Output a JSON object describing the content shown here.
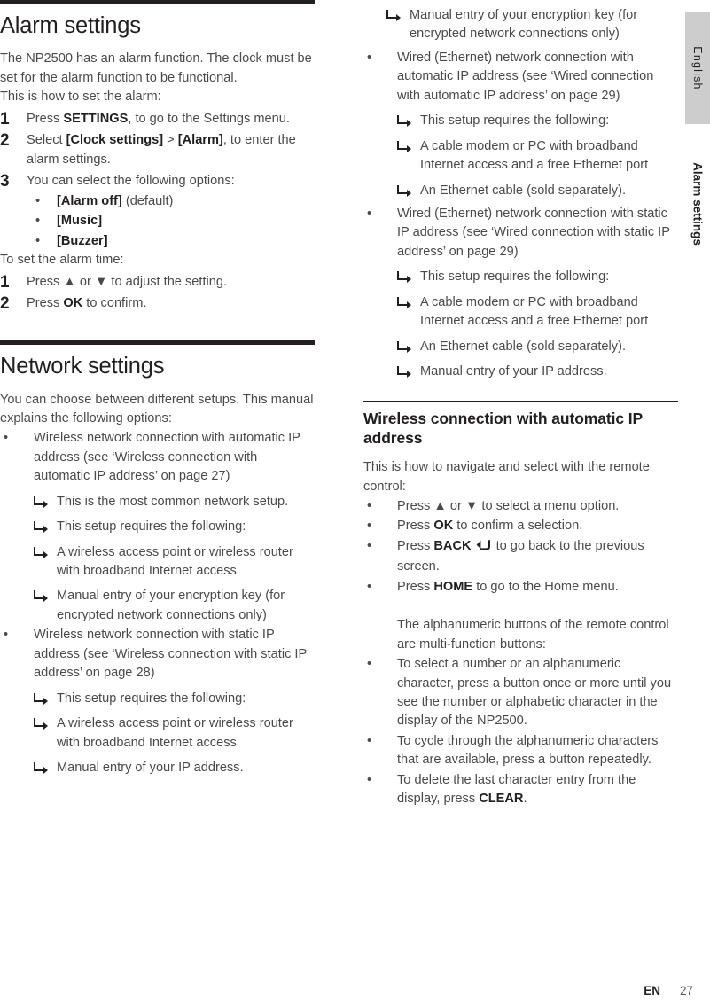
{
  "side_tab": {
    "language": "English",
    "chapter": "Alarm settings"
  },
  "footer": {
    "language_code": "EN",
    "page_number": "27"
  },
  "left_column": {
    "alarm_section": {
      "title": "Alarm settings",
      "intro": "The NP2500 has an alarm function. The clock must be set for the alarm function to be functional.",
      "intro2": "This is how to set the alarm:",
      "steps": [
        {
          "number": "1",
          "text_before": "Press ",
          "bold": "SETTINGS",
          "text_after": ", to go to the Settings menu."
        },
        {
          "number": "2",
          "text_before": "Select ",
          "bold": "[Clock settings]",
          "text_mid": " > ",
          "bold2": "[Alarm]",
          "text_after": ", to enter the alarm settings."
        },
        {
          "number": "3",
          "text_before": "You can select the following options:",
          "options": [
            {
              "bold": "[Alarm off]",
              "suffix": " (default)"
            },
            {
              "bold": "[Music]",
              "suffix": ""
            },
            {
              "bold": "[Buzzer]",
              "suffix": ""
            }
          ]
        }
      ],
      "time_intro": "To set the alarm time:",
      "time_steps": [
        {
          "number": "1",
          "text_before": "Press ",
          "symbol_up": "▲",
          "text_mid": " or ",
          "symbol_down": "▼",
          "text_after": " to adjust the setting."
        },
        {
          "number": "2",
          "text_before": "Press ",
          "bold": "OK",
          "text_after": " to confirm."
        }
      ]
    },
    "network_section": {
      "title": "Network settings",
      "intro": "You can choose between different setups. This manual explains the following options:",
      "bullets": [
        {
          "mark": "•",
          "text": "Wireless network connection with automatic IP address (see ‘Wireless connection with automatic IP address’ on page 27)",
          "subs": [
            "This is the most common network setup.",
            "This setup requires the following:",
            "A wireless access point or wireless router with broadband Internet access",
            "Manual entry of your encryption key (for encrypted network connections only)"
          ]
        },
        {
          "mark": "•",
          "text": "Wireless network connection with static IP address (see ‘Wireless connection with static IP address’ on page 28)",
          "subs": [
            "This setup requires the following:",
            "A wireless access point or wireless router with broadband Internet access",
            "Manual entry of your IP address."
          ]
        }
      ]
    }
  },
  "right_column": {
    "continued_subs_top": [
      "Manual entry of your encryption key (for encrypted network connections only)"
    ],
    "bullets": [
      {
        "mark": "•",
        "text": "Wired (Ethernet) network connection with automatic IP address (see ‘Wired connection with automatic IP address’ on page 29)",
        "subs": [
          "This setup requires the following:",
          "A cable modem or PC with broadband Internet access and a free Ethernet port",
          "An Ethernet cable (sold separately)."
        ]
      },
      {
        "mark": "•",
        "text": "Wired (Ethernet) network connection with static IP address (see ‘Wired connection with static IP address’ on page 29)",
        "subs": [
          "This setup requires the following:",
          "A cable modem or PC with broadband Internet access and a free Ethernet port",
          "An Ethernet cable (sold separately).",
          "Manual entry of your IP address."
        ]
      }
    ],
    "wireless_section": {
      "title": "Wireless connection with automatic IP address",
      "intro": "This is how to navigate and select with the remote control:",
      "nav_bullets": [
        {
          "mark": "•",
          "text_before": "Press ",
          "symbol_up": "▲",
          "text_mid": " or ",
          "symbol_down": "▼",
          "text_after": " to select a menu option."
        },
        {
          "mark": "•",
          "text_before": "Press ",
          "bold": "OK",
          "text_after": " to confirm a selection."
        },
        {
          "mark": "•",
          "text_before": "Press ",
          "bold": "BACK",
          "icon": "back-arrow-icon",
          "text_after": " to go back to the previous screen."
        },
        {
          "mark": "•",
          "text_before": "Press ",
          "bold": "HOME",
          "text_after": " to go to the Home menu."
        }
      ],
      "alphanumeric_intro": "The alphanumeric buttons of the remote control are multi-function buttons:",
      "alphanumeric_bullets": [
        {
          "mark": "•",
          "text": "To select a number or an alphanumeric character, press a button once or more until you see the number or alphabetic character in the display of the NP2500."
        },
        {
          "mark": "•",
          "text": "To cycle through the alphanumeric characters that are available, press a button repeatedly."
        },
        {
          "mark": "•",
          "text_before": "To delete the last character entry from the display, press ",
          "bold": "CLEAR",
          "text_after": "."
        }
      ]
    }
  }
}
